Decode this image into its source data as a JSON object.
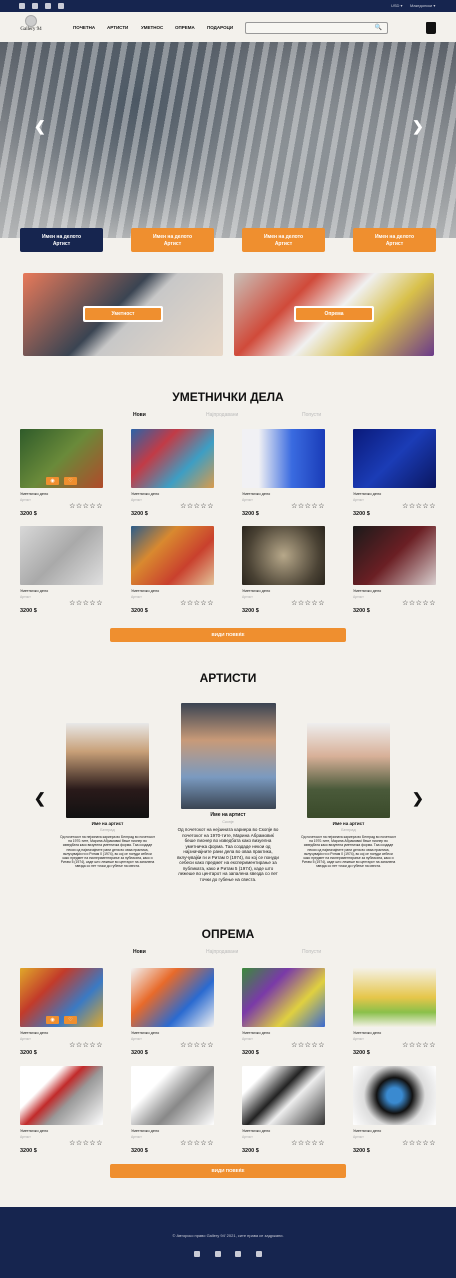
{
  "topbar": {
    "social": [
      "instagram-icon",
      "facebook-icon",
      "twitter-icon",
      "pinterest-icon"
    ],
    "currency": "USD ▾",
    "language": "Македонски ▾"
  },
  "header": {
    "logo": "Gallery 94",
    "nav": [
      "ПОЧЕТНА",
      "АРТИСТИ",
      "УМЕТНОС",
      "ОПРЕМА",
      "ПОДАРОЦИ"
    ],
    "search_placeholder": "",
    "search_icon": "🔍"
  },
  "hero": {
    "prev": "❮",
    "next": "❯",
    "slides": [
      {
        "title": "Имен на делото",
        "artist": "Артист"
      },
      {
        "title": "Имен на делото",
        "artist": "Артист"
      },
      {
        "title": "Имен на делото",
        "artist": "Артист"
      },
      {
        "title": "Имен на делото",
        "artist": "Артист"
      }
    ]
  },
  "categories": [
    "Уметност",
    "Опрема"
  ],
  "artworks": {
    "title": "УМЕТНИЧКИ ДЕЛА",
    "tabs": [
      "Нови",
      "Најпродавани",
      "Попусти"
    ],
    "more": "ВИДИ ПОВЕЌЕ",
    "items": [
      {
        "name": "Уметничко дело",
        "artist": "Артист",
        "price": "3200 $",
        "stars": "☆☆☆☆☆",
        "c": "linear-gradient(135deg,#2f5b2a,#6a8a3a,#b14a2a)"
      },
      {
        "name": "Уметничко дело",
        "artist": "Артист",
        "price": "3200 $",
        "stars": "☆☆☆☆☆",
        "c": "linear-gradient(135deg,#2a63a8,#c23b46,#3d9ec4,#d99b4b)"
      },
      {
        "name": "Уметничко дело",
        "artist": "Артист",
        "price": "3200 $",
        "stars": "☆☆☆☆☆",
        "c": "linear-gradient(90deg,#f1f1f4 20%,#3a6be0 60%,#1a3cb8)"
      },
      {
        "name": "Уметничко дело",
        "artist": "Артист",
        "price": "3200 $",
        "stars": "☆☆☆☆☆",
        "c": "linear-gradient(135deg,#0a1a7a,#1b3cb6,#0a1660)"
      },
      {
        "name": "Уметничко дело",
        "artist": "Артист",
        "price": "3200 $",
        "stars": "☆☆☆☆☆",
        "c": "linear-gradient(135deg,#d8d8d8,#a9a9a9,#e0e0e0)"
      },
      {
        "name": "Уметничко дело",
        "artist": "Артист",
        "price": "3200 $",
        "stars": "☆☆☆☆☆",
        "c": "linear-gradient(135deg,#2b5c8a,#d9892f,#c9402d,#e3c39a)"
      },
      {
        "name": "Уметничко дело",
        "artist": "Артист",
        "price": "3200 $",
        "stars": "☆☆☆☆☆",
        "c": "radial-gradient(circle,#b7a88a,#4a4234 70%,#2a251d)"
      },
      {
        "name": "Уметничко дело",
        "artist": "Артист",
        "price": "3200 $",
        "stars": "☆☆☆☆☆",
        "c": "linear-gradient(135deg,#1a1a1a,#6b1f24,#d9cfcf)"
      }
    ]
  },
  "artists": {
    "title": "АРТИСТИ",
    "prev": "❮",
    "next": "❯",
    "items": [
      {
        "name": "Име на артист",
        "city": "Белград",
        "bio": "Од почетокот на нејзината кариера во Белград во почетокот на 1970-тите, Марина Абрамовиќ беше пионер во изведбата како визуелна уметничка форма. Таа создаде некои од најзначајните рани дела во оваа практика, вклучувајќи ги и Ритам 0 (1974), во кој се понуди себеси како предмет на експериментирање за публиката, како и Ритам 5 (1974), каде што лежеше во центарот на запалена ѕвезда со пет точки до губење на свеста."
      },
      {
        "name": "Име на артист",
        "city": "Скопје",
        "bio": "Од почетокот на нејзината кариера во Скопје во почетокот на 1970-тите, Марина Абрамовиќ беше пионер во изведбата како визуелна уметничка форма. Таа создаде некои од најзначајните рани дела во оваа практика, вклучувајќи ги и Ритам 0 (1974), во кој се понуди себеси како предмет на експериментирање за публиката, како и Ритам 5 (1974), каде што лежеше во центарот на запалена ѕвезда со пет точки до губење на свеста."
      },
      {
        "name": "Име на артист",
        "city": "Белград",
        "bio": "Од почетокот на нејзината кариера во Белград во почетокот на 1970-тите, Марина Абрамовиќ беше пионер во изведбата како визуелна уметничка форма. Таа создаде некои од најзначајните рани дела во оваа практика, вклучувајќи ги и Ритам 0 (1974), во кој се понуди себеси како предмет на експериментирање за публиката, како и Ритам 5 (1974), каде што лежеше во центарот на запалена ѕвезда со пет точки до губење на свеста."
      }
    ]
  },
  "equipment": {
    "title": "ОПРЕМА",
    "tabs": [
      "Нови",
      "Најпродавани",
      "Попусти"
    ],
    "more": "ВИДИ ПОВЕЌЕ",
    "items": [
      {
        "name": "Уметничко дело",
        "artist": "Артист",
        "price": "3200 $",
        "stars": "☆☆☆☆☆",
        "c": "linear-gradient(135deg,#e0a82a,#c23b2a,#3a7ac4,#e0a82a)"
      },
      {
        "name": "Уметничко дело",
        "artist": "Артист",
        "price": "3200 $",
        "stars": "☆☆☆☆☆",
        "c": "linear-gradient(135deg,#f2f2f2,#e86a2a,#2a6ad0,#f2f2f2)"
      },
      {
        "name": "Уметничко дело",
        "artist": "Артист",
        "price": "3200 $",
        "stars": "☆☆☆☆☆",
        "c": "linear-gradient(135deg,#3a8a3a,#7a3aa8,#e0d040,#3a6ad0)"
      },
      {
        "name": "Уметничко дело",
        "artist": "Артист",
        "price": "3200 $",
        "stars": "☆☆☆☆☆",
        "c": "linear-gradient(180deg,#f4f1e6,#e6c64a 50%,#8ac04a,#f4f1e6)"
      },
      {
        "name": "Уметничко дело",
        "artist": "Артист",
        "price": "3200 $",
        "stars": "☆☆☆☆☆",
        "c": "linear-gradient(135deg,#fff 30%,#c22a2a 45%,#999 60%,#fff)"
      },
      {
        "name": "Уметничко дело",
        "artist": "Артист",
        "price": "3200 $",
        "stars": "☆☆☆☆☆",
        "c": "linear-gradient(135deg,#fff 30%,#aaa 50%,#888 60%,#fff)"
      },
      {
        "name": "Уметничко дело",
        "artist": "Артист",
        "price": "3200 $",
        "stars": "☆☆☆☆☆",
        "c": "linear-gradient(135deg,#fff 20%,#222 45%,#eee 60%,#333)"
      },
      {
        "name": "Уметничко дело",
        "artist": "Артист",
        "price": "3200 $",
        "stars": "☆☆☆☆☆",
        "c": "radial-gradient(circle,#3a8ad0 15%,#111 35%,#ddd 60%,#fff)"
      }
    ]
  },
  "footer": {
    "copyright": "© Авторско право Gallery 94' 2021, сите права се задржани."
  },
  "colors": {
    "navy": "#16254f",
    "orange": "#ef8f2f",
    "bg": "#f3f1ec"
  }
}
